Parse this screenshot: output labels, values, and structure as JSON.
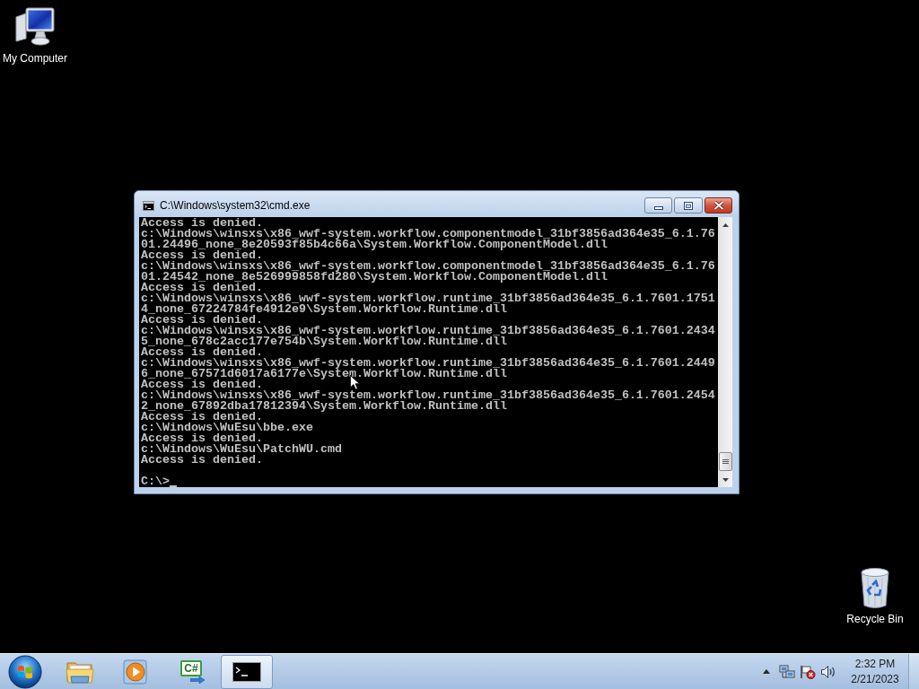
{
  "desktop_icons": [
    {
      "kind": "computer",
      "label": "My Computer"
    },
    {
      "kind": "recycle-bin",
      "label": "Recycle Bin"
    }
  ],
  "window": {
    "title": "C:\\Windows\\system32\\cmd.exe",
    "console": {
      "lines": [
        "Access is denied.",
        "c:\\Windows\\winsxs\\x86_wwf-system.workflow.componentmodel_31bf3856ad364e35_6.1.76",
        "01.24496_none_8e20593f85b4c66a\\System.Workflow.ComponentModel.dll",
        "Access is denied.",
        "c:\\Windows\\winsxs\\x86_wwf-system.workflow.componentmodel_31bf3856ad364e35_6.1.76",
        "01.24542_none_8e526999858fd280\\System.Workflow.ComponentModel.dll",
        "Access is denied.",
        "c:\\Windows\\winsxs\\x86_wwf-system.workflow.runtime_31bf3856ad364e35_6.1.7601.1751",
        "4_none_67224784fe4912e9\\System.Workflow.Runtime.dll",
        "Access is denied.",
        "c:\\Windows\\winsxs\\x86_wwf-system.workflow.runtime_31bf3856ad364e35_6.1.7601.2434",
        "5_none_678c2acc177e754b\\System.Workflow.Runtime.dll",
        "Access is denied.",
        "c:\\Windows\\winsxs\\x86_wwf-system.workflow.runtime_31bf3856ad364e35_6.1.7601.2449",
        "6_none_67571d6017a6177e\\System.Workflow.Runtime.dll",
        "Access is denied.",
        "c:\\Windows\\winsxs\\x86_wwf-system.workflow.runtime_31bf3856ad364e35_6.1.7601.2454",
        "2_none_67892dba17812394\\System.Workflow.Runtime.dll",
        "Access is denied.",
        "c:\\Windows\\WuEsu\\bbe.exe",
        "Access is denied.",
        "c:\\Windows\\WuEsu\\PatchWU.cmd",
        "Access is denied."
      ],
      "prompt": "C:\\>"
    }
  },
  "taskbar": {
    "pinned": [
      {
        "kind": "explorer",
        "selected": false
      },
      {
        "kind": "media-player",
        "selected": false
      },
      {
        "kind": "code-editor",
        "label": "C#",
        "selected": false
      },
      {
        "kind": "console",
        "selected": true
      }
    ],
    "clock": {
      "time": "2:32 PM",
      "date": "2/21/2023"
    }
  }
}
